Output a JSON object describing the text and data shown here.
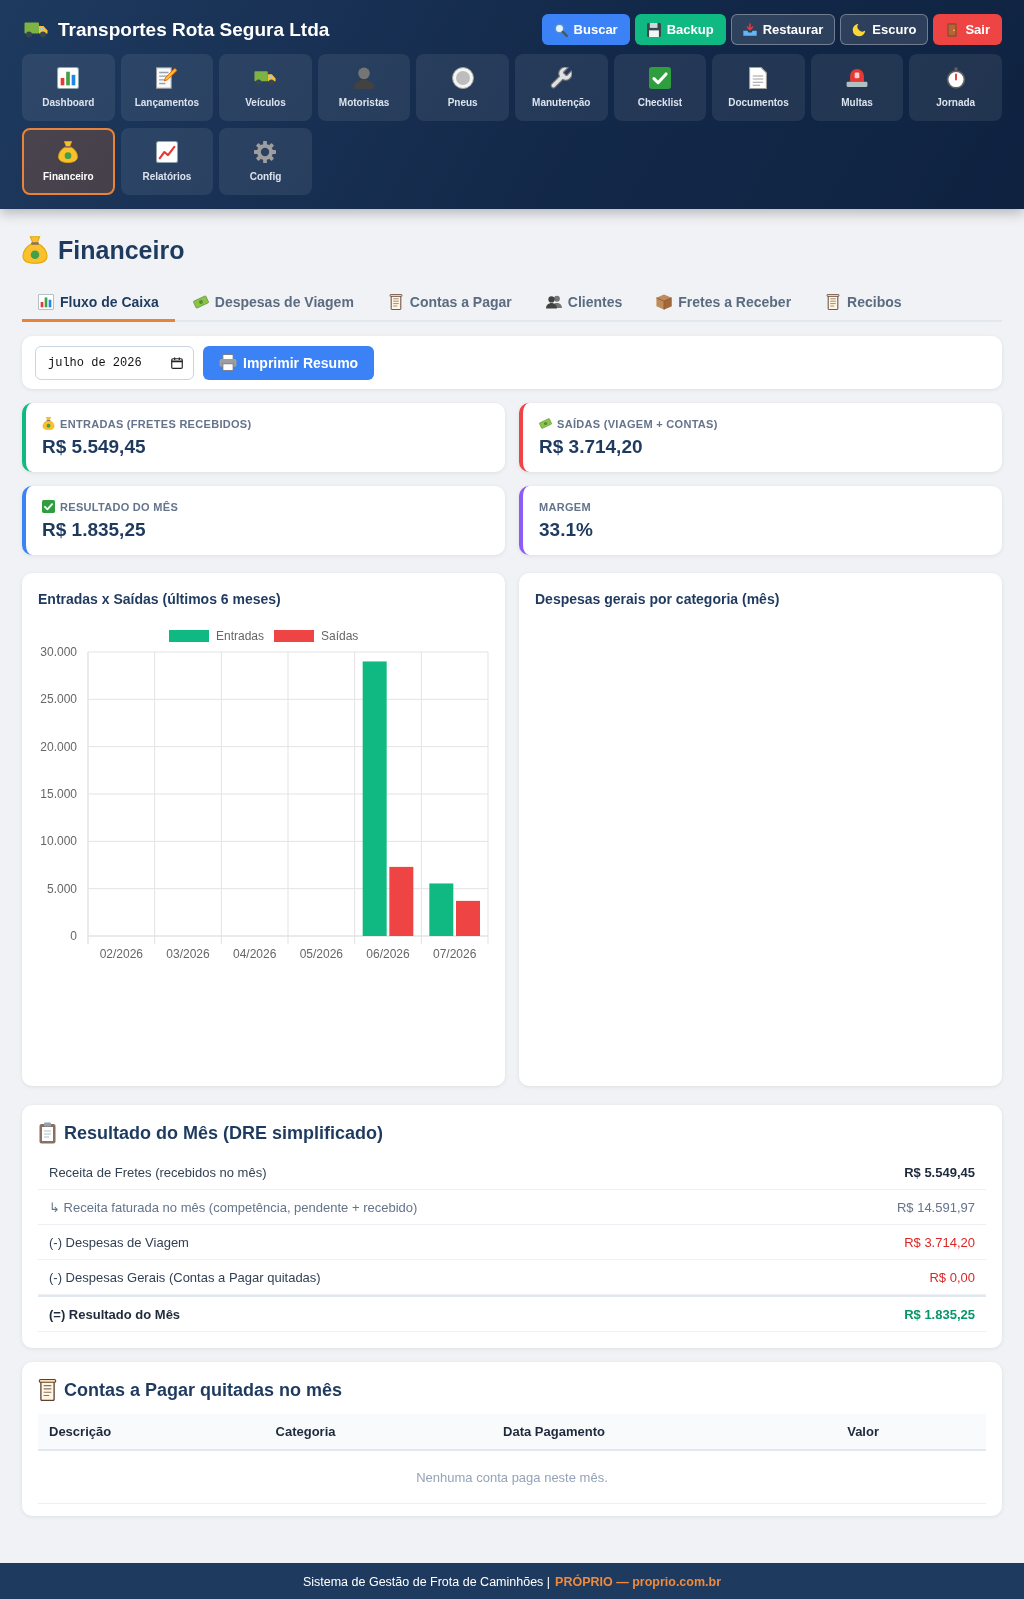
{
  "header": {
    "title": "Transportes Rota Segura Ltda",
    "actions": [
      {
        "label": "Buscar",
        "kind": "primary"
      },
      {
        "label": "Backup",
        "kind": "success"
      },
      {
        "label": "Restaurar",
        "kind": "outline"
      },
      {
        "label": "Escuro",
        "kind": "outline"
      },
      {
        "label": "Sair",
        "kind": "danger"
      }
    ]
  },
  "nav": [
    {
      "label": "Dashboard",
      "selected": false
    },
    {
      "label": "Lançamentos",
      "selected": false
    },
    {
      "label": "Veículos",
      "selected": false
    },
    {
      "label": "Motoristas",
      "selected": false
    },
    {
      "label": "Pneus",
      "selected": false
    },
    {
      "label": "Manutenção",
      "selected": false
    },
    {
      "label": "Checklist",
      "selected": false
    },
    {
      "label": "Documentos",
      "selected": false
    },
    {
      "label": "Multas",
      "selected": false
    },
    {
      "label": "Jornada",
      "selected": false
    },
    {
      "label": "Financeiro",
      "selected": true
    },
    {
      "label": "Relatórios",
      "selected": false
    },
    {
      "label": "Config",
      "selected": false
    }
  ],
  "page": {
    "title": "Financeiro"
  },
  "tabs": [
    {
      "label": "Fluxo de Caixa",
      "selected": true
    },
    {
      "label": "Despesas de Viagem",
      "selected": false
    },
    {
      "label": "Contas a Pagar",
      "selected": false
    },
    {
      "label": "Clientes",
      "selected": false
    },
    {
      "label": "Fretes a Receber",
      "selected": false
    },
    {
      "label": "Recibos",
      "selected": false
    }
  ],
  "toolbar": {
    "month": "julho de 2026",
    "print_button": "Imprimir Resumo"
  },
  "stats": [
    {
      "label": "ENTRADAS (FRETES RECEBIDOS)",
      "value": "R$ 5.549,45",
      "color": "#10b981"
    },
    {
      "label": "SAÍDAS (VIAGEM + CONTAS)",
      "value": "R$ 3.714,20",
      "color": "#ef4444"
    },
    {
      "label": "RESULTADO DO MÊS",
      "value": "R$ 1.835,25",
      "color": "#3b82f6"
    },
    {
      "label": "MARGEM",
      "value": "33.1%",
      "color": "#8b5cf6"
    }
  ],
  "charts": [
    {
      "title": "Entradas x Saídas (últimos 6 meses)",
      "chart_data": {
        "type": "bar",
        "categories": [
          "02/2026",
          "03/2026",
          "04/2026",
          "05/2026",
          "06/2026",
          "07/2026"
        ],
        "series": [
          {
            "name": "Entradas",
            "color": "#10b981",
            "values": [
              0,
              0,
              0,
              0,
              29000,
              5550
            ]
          },
          {
            "name": "Saídas",
            "color": "#ef4444",
            "values": [
              0,
              0,
              0,
              0,
              7300,
              3710
            ]
          }
        ],
        "ylim": [
          0,
          30000
        ],
        "yticks": [
          {
            "value": 0,
            "label": "0"
          },
          {
            "value": 5000,
            "label": "5.000"
          },
          {
            "value": 10000,
            "label": "10.000"
          },
          {
            "value": 15000,
            "label": "15.000"
          },
          {
            "value": 20000,
            "label": "20.000"
          },
          {
            "value": 25000,
            "label": "25.000"
          },
          {
            "value": 30000,
            "label": "30.000"
          }
        ],
        "grid": true,
        "legend": true
      }
    },
    {
      "title": "Despesas gerais por categoria (mês)"
    }
  ],
  "dre": {
    "title": "Resultado do Mês (DRE simplificado)",
    "rows": [
      {
        "label": "Receita de Fretes (recebidos no mês)",
        "value": "R$ 5.549,45",
        "kind": "revenue"
      },
      {
        "label": "↳ Receita faturada no mês (competência, pendente + recebido)",
        "value": "R$ 14.591,97",
        "kind": "note"
      },
      {
        "label": "(-) Despesas de Viagem",
        "value": "R$ 3.714,20",
        "kind": "expense"
      },
      {
        "label": "(-) Despesas Gerais (Contas a Pagar quitadas)",
        "value": "R$ 0,00",
        "kind": "expense"
      },
      {
        "label": "(=) Resultado do Mês",
        "value": "R$ 1.835,25",
        "kind": "total"
      }
    ]
  },
  "paid_bills": {
    "title": "Contas a Pagar quitadas no mês",
    "columns": [
      "Descrição",
      "Categoria",
      "Data Pagamento",
      "Valor"
    ],
    "empty_message": "Nenhuma conta paga neste mês."
  },
  "footer": {
    "text": "Sistema de Gestão de Frota de Caminhões |",
    "link": "PRÓPRIO — proprio.com.br"
  }
}
